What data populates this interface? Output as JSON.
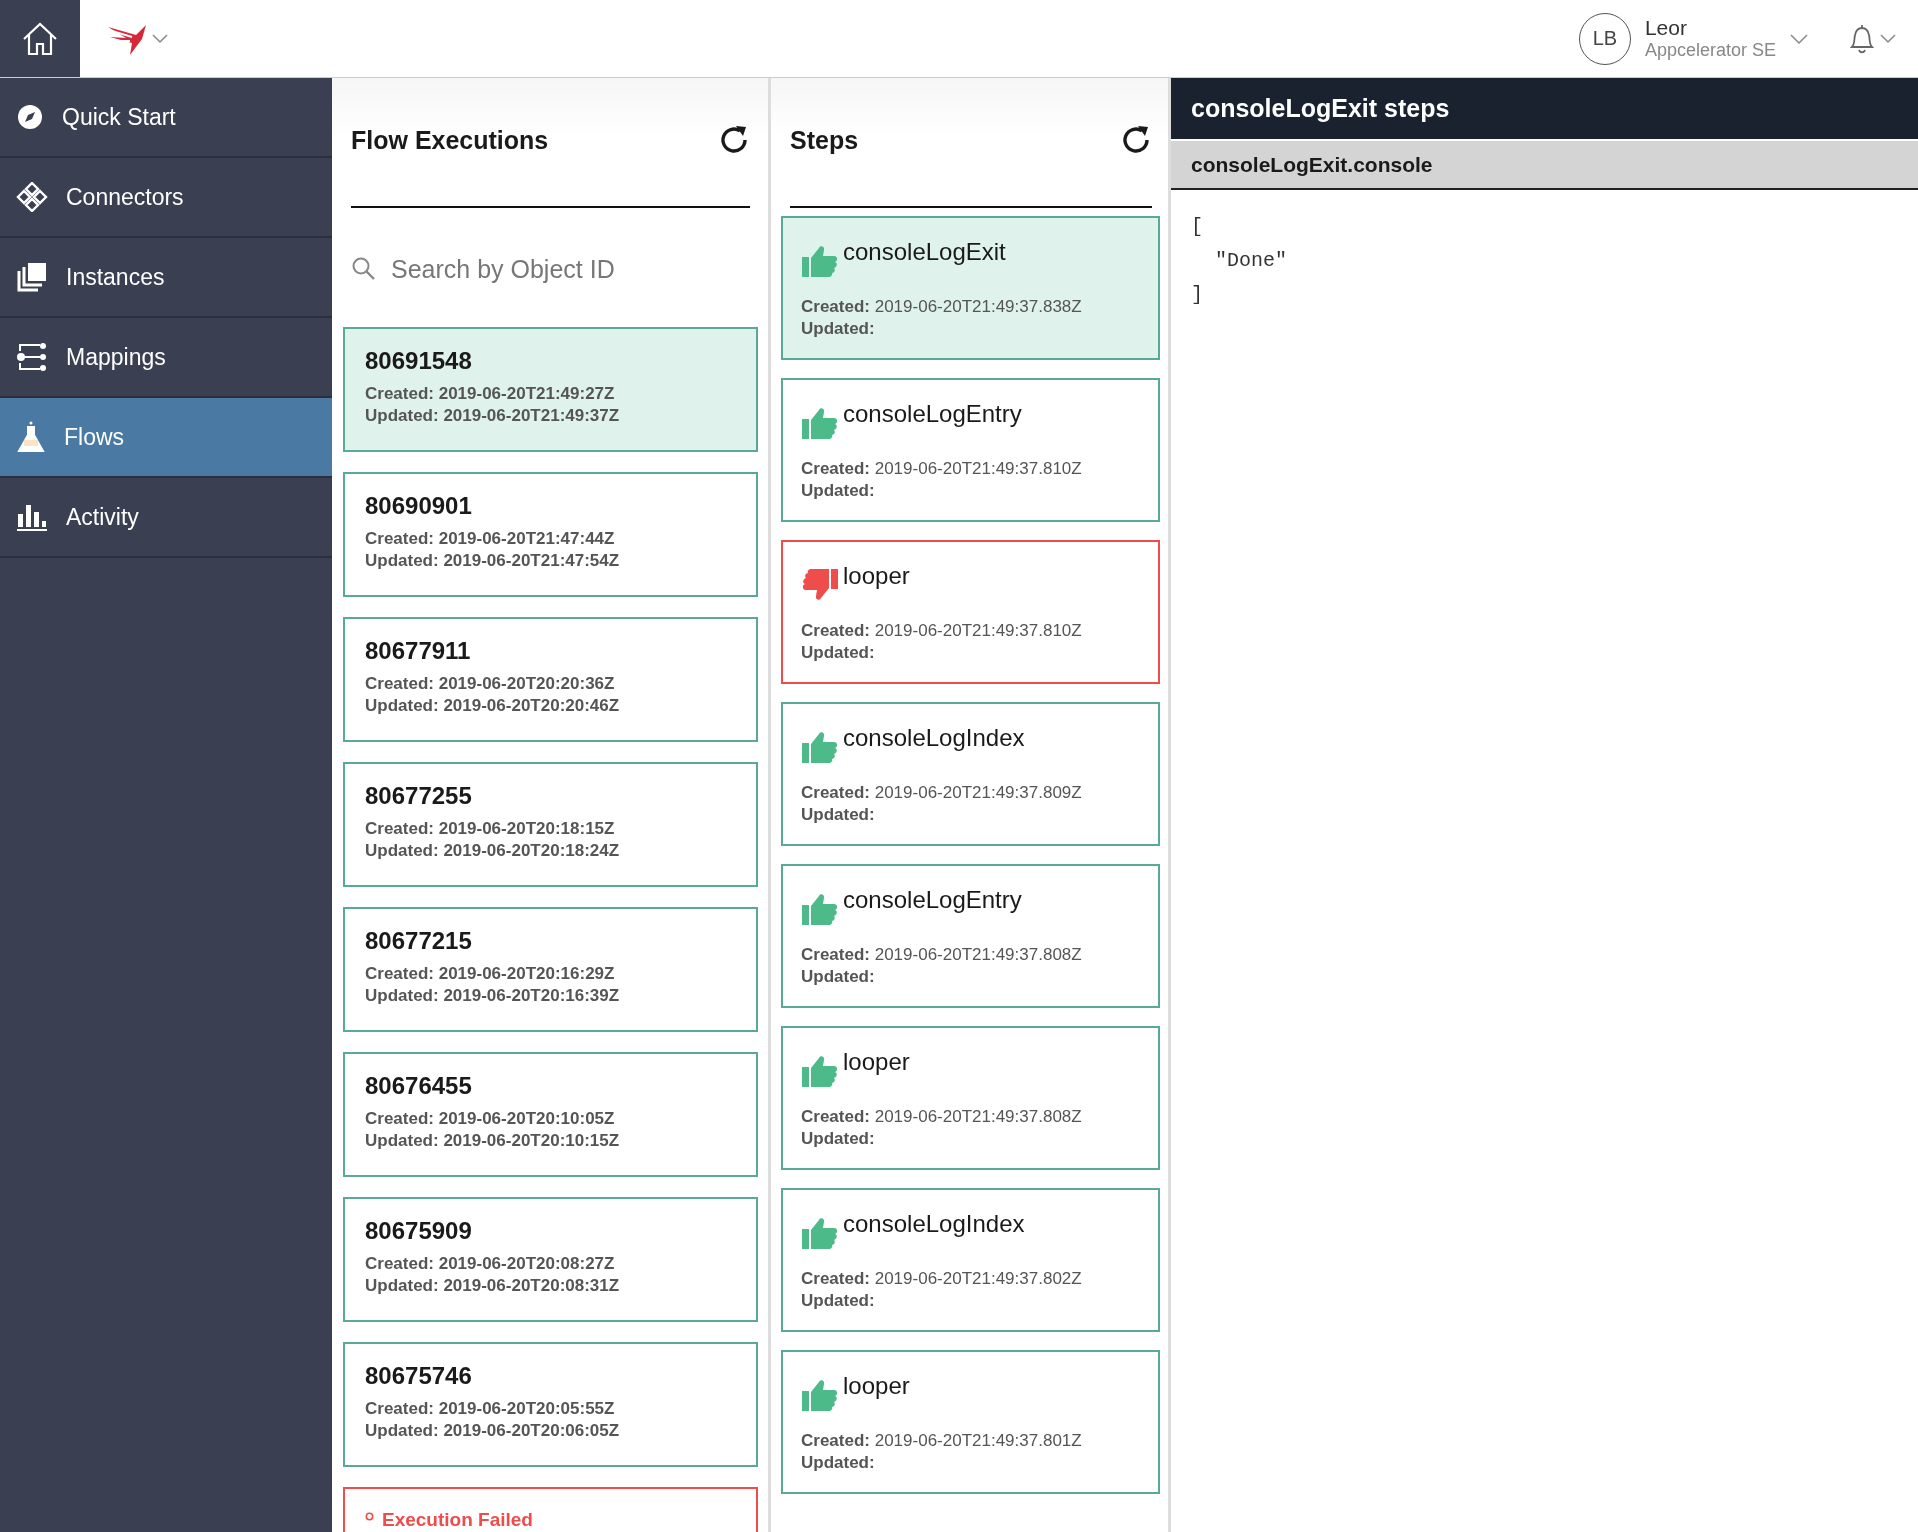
{
  "topbar": {
    "avatar_initials": "LB",
    "user_name": "Leor",
    "user_org": "Appcelerator SE"
  },
  "sidebar": {
    "items": [
      {
        "label": "Quick Start",
        "selected": false
      },
      {
        "label": "Connectors",
        "selected": false
      },
      {
        "label": "Instances",
        "selected": false
      },
      {
        "label": "Mappings",
        "selected": false
      },
      {
        "label": "Flows",
        "selected": true
      },
      {
        "label": "Activity",
        "selected": false
      }
    ]
  },
  "executions": {
    "title": "Flow Executions",
    "search": {
      "placeholder": "Search by Object ID"
    },
    "items": [
      {
        "kind": "execution",
        "id": "80691548",
        "created": "Created: 2019-06-20T21:49:27Z",
        "updated": "Updated: 2019-06-20T21:49:37Z",
        "selected": true
      },
      {
        "kind": "execution",
        "id": "80690901",
        "created": "Created: 2019-06-20T21:47:44Z",
        "updated": "Updated: 2019-06-20T21:47:54Z",
        "selected": false
      },
      {
        "kind": "execution",
        "id": "80677911",
        "created": "Created: 2019-06-20T20:20:36Z",
        "updated": "Updated: 2019-06-20T20:20:46Z",
        "selected": false
      },
      {
        "kind": "execution",
        "id": "80677255",
        "created": "Created: 2019-06-20T20:18:15Z",
        "updated": "Updated: 2019-06-20T20:18:24Z",
        "selected": false
      },
      {
        "kind": "execution",
        "id": "80677215",
        "created": "Created: 2019-06-20T20:16:29Z",
        "updated": "Updated: 2019-06-20T20:16:39Z",
        "selected": false
      },
      {
        "kind": "execution",
        "id": "80676455",
        "created": "Created: 2019-06-20T20:10:05Z",
        "updated": "Updated: 2019-06-20T20:10:15Z",
        "selected": false
      },
      {
        "kind": "execution",
        "id": "80675909",
        "created": "Created: 2019-06-20T20:08:27Z",
        "updated": "Updated: 2019-06-20T20:08:31Z",
        "selected": false
      },
      {
        "kind": "execution",
        "id": "80675746",
        "created": "Created: 2019-06-20T20:05:55Z",
        "updated": "Updated: 2019-06-20T20:06:05Z",
        "selected": false
      },
      {
        "kind": "failed",
        "error": "Execution Failed",
        "selected": false
      }
    ]
  },
  "steps": {
    "title": "Steps",
    "items": [
      {
        "name": "consoleLogExit",
        "kind": "success",
        "created_label": "Created:",
        "created": "2019-06-20T21:49:37.838Z",
        "updated_label": "Updated:",
        "selected": true
      },
      {
        "name": "consoleLogEntry",
        "kind": "success",
        "created_label": "Created:",
        "created": "2019-06-20T21:49:37.810Z",
        "updated_label": "Updated:",
        "selected": false
      },
      {
        "name": "looper",
        "kind": "failed",
        "created_label": "Created:",
        "created": "2019-06-20T21:49:37.810Z",
        "updated_label": "Updated:",
        "selected": false
      },
      {
        "name": "consoleLogIndex",
        "kind": "success",
        "created_label": "Created:",
        "created": "2019-06-20T21:49:37.809Z",
        "updated_label": "Updated:",
        "selected": false
      },
      {
        "name": "consoleLogEntry",
        "kind": "success",
        "created_label": "Created:",
        "created": "2019-06-20T21:49:37.808Z",
        "updated_label": "Updated:",
        "selected": false
      },
      {
        "name": "looper",
        "kind": "success",
        "created_label": "Created:",
        "created": "2019-06-20T21:49:37.808Z",
        "updated_label": "Updated:",
        "selected": false
      },
      {
        "name": "consoleLogIndex",
        "kind": "success",
        "created_label": "Created:",
        "created": "2019-06-20T21:49:37.802Z",
        "updated_label": "Updated:",
        "selected": false
      },
      {
        "name": "looper",
        "kind": "success",
        "created_label": "Created:",
        "created": "2019-06-20T21:49:37.801Z",
        "updated_label": "Updated:",
        "selected": false
      }
    ]
  },
  "detail": {
    "title": "consoleLogExit steps",
    "section": "consoleLogExit.console",
    "output_lines": [
      "[",
      "  \"Done\"",
      "]"
    ]
  }
}
